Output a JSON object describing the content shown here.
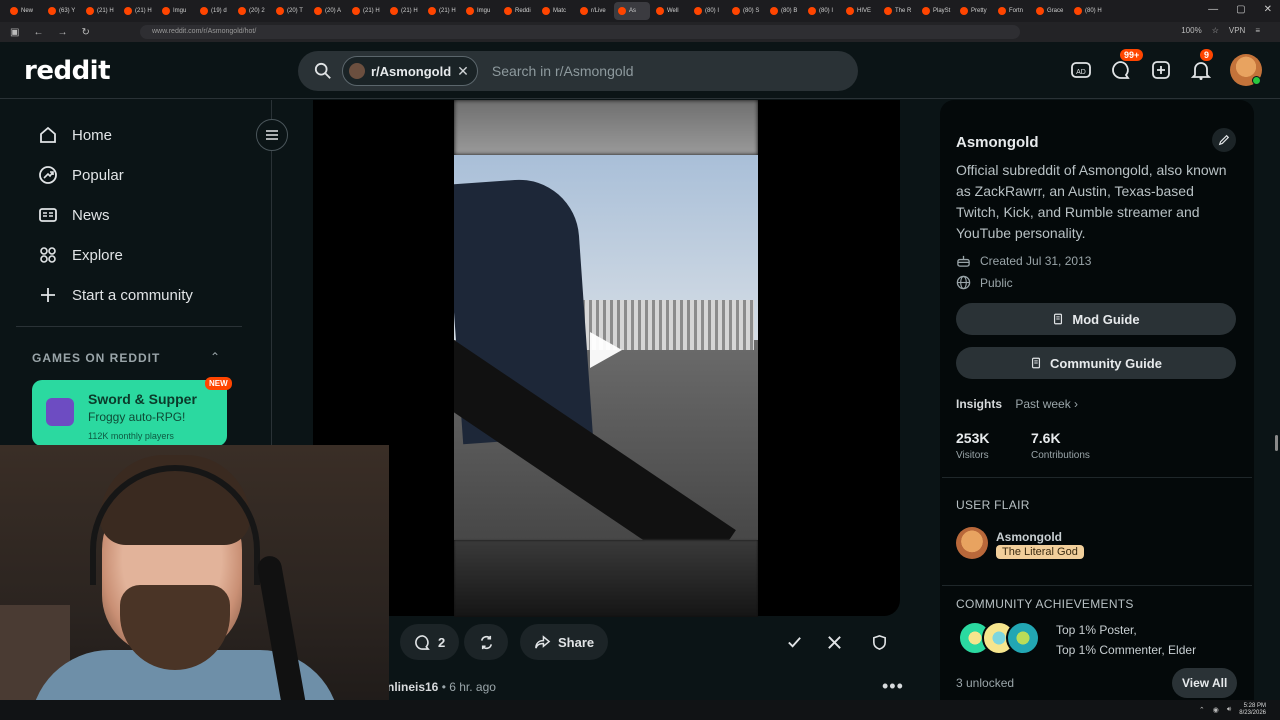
{
  "browser": {
    "tabs": [
      {
        "label": "New"
      },
      {
        "label": "(63) Y"
      },
      {
        "label": "(21) H"
      },
      {
        "label": "(21) H"
      },
      {
        "label": "Imgu"
      },
      {
        "label": "(19) d"
      },
      {
        "label": "(20) 2"
      },
      {
        "label": "(20) T"
      },
      {
        "label": "(20) A"
      },
      {
        "label": "(21) H"
      },
      {
        "label": "(21) H"
      },
      {
        "label": "(21) H"
      },
      {
        "label": "Imgu"
      },
      {
        "label": "Reddi"
      },
      {
        "label": "Matc"
      },
      {
        "label": "r/Live"
      },
      {
        "label": "As"
      },
      {
        "label": "Well"
      },
      {
        "label": "(80) I"
      },
      {
        "label": "(80) S"
      },
      {
        "label": "(80) B"
      },
      {
        "label": "(80) I"
      },
      {
        "label": "HIVE"
      },
      {
        "label": "The R"
      },
      {
        "label": "PlaySt"
      },
      {
        "label": "Pretty"
      },
      {
        "label": "Fortn"
      },
      {
        "label": "Grace"
      },
      {
        "label": "(80) H"
      }
    ],
    "url": "www.reddit.com/r/Asmongold/hot/",
    "zoom": "100%",
    "vpn": "VPN"
  },
  "header": {
    "logo": "reddit",
    "community_chip": "r/Asmongold",
    "search_placeholder": "Search in r/Asmongold",
    "chat_badge": "99+",
    "notif_badge": "9"
  },
  "sidebar": {
    "items": [
      {
        "label": "Home",
        "icon": "home-icon"
      },
      {
        "label": "Popular",
        "icon": "popular-icon"
      },
      {
        "label": "News",
        "icon": "news-icon"
      },
      {
        "label": "Explore",
        "icon": "explore-icon"
      },
      {
        "label": "Start a community",
        "icon": "plus-icon"
      }
    ],
    "games_heading": "GAMES ON REDDIT",
    "game": {
      "badge": "NEW",
      "title": "Sword & Supper",
      "subtitle": "Froggy auto-RPG!",
      "players": "112K monthly players"
    }
  },
  "post": {
    "comments": "2",
    "share": "Share",
    "author": "nlineis16",
    "time": "• 6 hr. ago"
  },
  "community": {
    "name": "Asmongold",
    "description": "Official subreddit of Asmongold, also known as ZackRawrr, an Austin, Texas-based Twitch, Kick, and Rumble streamer and YouTube personality.",
    "created": "Created Jul 31, 2013",
    "visibility": "Public",
    "mod_guide": "Mod Guide",
    "community_guide": "Community Guide",
    "insights_label": "Insights",
    "insights_period": "Past week ›",
    "visitors_value": "253K",
    "visitors_label": "Visitors",
    "contributions_value": "7.6K",
    "contributions_label": "Contributions",
    "user_flair_heading": "USER FLAIR",
    "flair_user": "Asmongold",
    "flair_tag": "The Literal God",
    "achievements_heading": "COMMUNITY ACHIEVEMENTS",
    "achievement_line1": "Top 1% Poster,",
    "achievement_line2": "Top 1% Commenter, Elder",
    "unlocked": "3 unlocked",
    "view_all": "View All"
  },
  "taskbar": {
    "time": "5:28 PM",
    "date": "8/23/2026"
  },
  "colors": {
    "background": "#0b1416",
    "accent": "#ff4500",
    "game_card": "#2bd9a0"
  }
}
